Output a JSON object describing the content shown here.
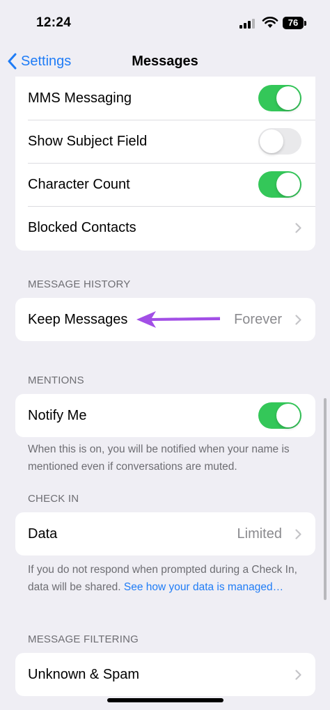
{
  "status": {
    "time": "12:24",
    "battery": "76"
  },
  "nav": {
    "back_label": "Settings",
    "title": "Messages"
  },
  "sms_group": {
    "mms": {
      "label": "MMS Messaging",
      "toggle": "on"
    },
    "subject": {
      "label": "Show Subject Field",
      "toggle": "off"
    },
    "count": {
      "label": "Character Count",
      "toggle": "on"
    },
    "blocked": {
      "label": "Blocked Contacts"
    }
  },
  "history": {
    "header": "MESSAGE HISTORY",
    "keep": {
      "label": "Keep Messages",
      "value": "Forever"
    }
  },
  "mentions": {
    "header": "MENTIONS",
    "notify": {
      "label": "Notify Me",
      "toggle": "on"
    },
    "footnote": "When this is on, you will be notified when your name is mentioned even if conversations are muted."
  },
  "checkin": {
    "header": "CHECK IN",
    "data": {
      "label": "Data",
      "value": "Limited"
    },
    "footnote": "If you do not respond when prompted during a Check In, data will be shared.",
    "link": "See how your data is managed…"
  },
  "filtering": {
    "header": "MESSAGE FILTERING",
    "spam": {
      "label": "Unknown & Spam"
    }
  },
  "colors": {
    "accent": "#1f7cf6",
    "toggle_on": "#34c759",
    "annotation_arrow": "#a24fe6"
  }
}
